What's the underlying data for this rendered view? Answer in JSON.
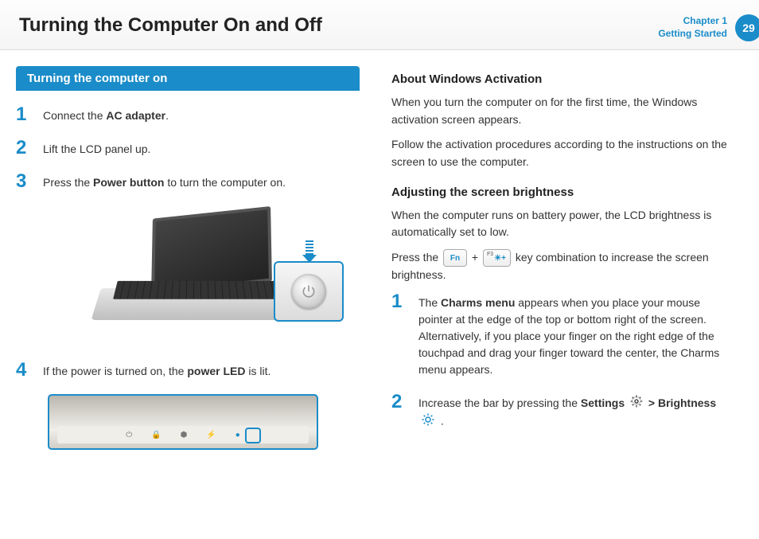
{
  "header": {
    "title": "Turning the Computer On and Off",
    "chapter_line1": "Chapter 1",
    "chapter_line2": "Getting Started",
    "page_number": "29"
  },
  "left": {
    "section_title": "Turning the computer on",
    "steps": [
      {
        "num": "1",
        "pre": "Connect the ",
        "bold": "AC adapter",
        "post": "."
      },
      {
        "num": "2",
        "pre": "Lift the LCD panel up.",
        "bold": "",
        "post": ""
      },
      {
        "num": "3",
        "pre": "Press the ",
        "bold": "Power button",
        "post": " to turn the computer on."
      },
      {
        "num": "4",
        "pre": "If the power is turned on, the ",
        "bold": "power LED",
        "post": " is lit."
      }
    ]
  },
  "right": {
    "activation": {
      "heading": "About Windows Activation",
      "p1": "When you turn the computer on for the first time, the Windows activation screen appears.",
      "p2": "Follow the activation procedures according to the instructions on the screen to use the computer."
    },
    "brightness": {
      "heading": "Adjusting the screen brightness",
      "p1": "When the computer runs on battery power, the LCD brightness is automatically set to low.",
      "press_pre": "Press the ",
      "key_fn": "Fn",
      "plus": "+",
      "key_f3_sup": "F3",
      "press_post": " key combination to increase the screen brightness.",
      "steps": [
        {
          "num": "1",
          "pre": "The ",
          "bold": "Charms menu",
          "post": " appears when you place your mouse pointer at the edge of the top or bottom right of the screen. Alternatively, if you place your finger on the right edge of the touchpad and drag your finger toward the center, the Charms menu appears."
        },
        {
          "num": "2",
          "pre": "Increase the bar by pressing the ",
          "bold1": "Settings",
          "mid": " > ",
          "bold2": "Brightness",
          "post": " ."
        }
      ]
    }
  }
}
